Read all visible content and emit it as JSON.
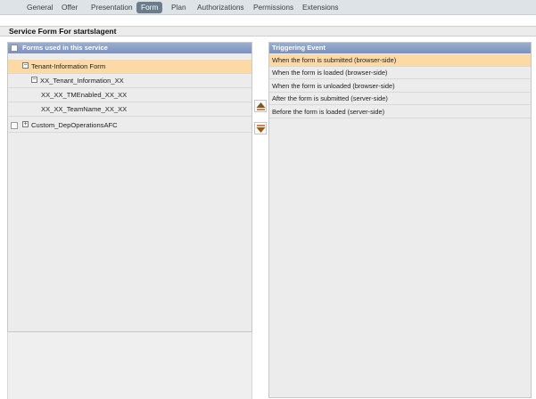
{
  "tabs": [
    {
      "label": "General",
      "active": false
    },
    {
      "label": "Offer",
      "active": false
    },
    {
      "label": "Presentation",
      "active": false
    },
    {
      "label": "Form",
      "active": true
    },
    {
      "label": "Plan",
      "active": false
    },
    {
      "label": "Authorizations",
      "active": false
    },
    {
      "label": "Permissions",
      "active": false
    },
    {
      "label": "Extensions",
      "active": false
    }
  ],
  "page_title": "Service Form For startslagent",
  "forms_panel": {
    "header": "Forms used in this service",
    "rows": [
      {
        "label": "Tenant-Information Form",
        "selected": true
      },
      {
        "label": "XX_Tenant_Information_XX"
      },
      {
        "label": "XX_XX_TMEnabled_XX_XX"
      },
      {
        "label": "XX_XX_TeamName_XX_XX"
      },
      {
        "label": "Custom_DepOperationsAFC"
      }
    ]
  },
  "events_panel": {
    "header": "Triggering Event",
    "rows": [
      {
        "label": "When the form is submitted (browser-side)",
        "selected": true
      },
      {
        "label": "When the form is loaded (browser-side)"
      },
      {
        "label": "When the form is unloaded (browser-side)"
      },
      {
        "label": "After the form is submitted (server-side)"
      },
      {
        "label": "Before the form is loaded (server-side)"
      }
    ]
  },
  "icons": {
    "move_up": "move-up-icon",
    "move_down": "move-down-icon",
    "expander_open": "minus-expander-icon",
    "expander_closed": "plus-expander-icon"
  },
  "colors": {
    "tab_active": "#6a7d8c",
    "panel_header": "#8a9fc9",
    "selected_row": "#fdd9a6",
    "arrow_up": "#7a5a1e",
    "arrow_down": "#a05a10"
  }
}
